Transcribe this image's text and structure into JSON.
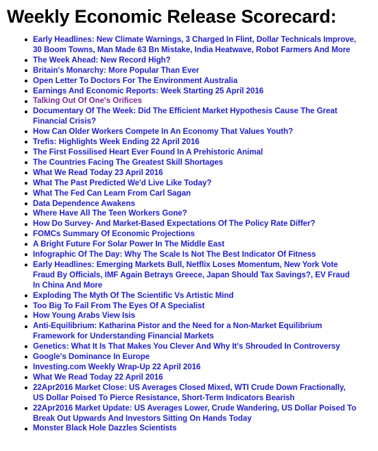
{
  "page": {
    "title": "Weekly Economic Release Scorecard:",
    "background_color": "#ffffff",
    "title_color": "#000000",
    "link_color": "#2222cc",
    "visited_link_color": "#7a2a9e",
    "bullet_glyph": "bullet-point"
  },
  "list": {
    "items": [
      {
        "label": "Early Headlines: New Climate Warnings, 3 Charged In Flint, Dollar Technicals Improve, 30 Boom Towns, Man Made 63 Bn Mistake, India Heatwave, Robot Farmers And More",
        "state": "unvisited"
      },
      {
        "label": "The Week Ahead: New Record High?",
        "state": "unvisited"
      },
      {
        "label": "Britain's Monarchy: More Popular Than Ever",
        "state": "unvisited"
      },
      {
        "label": "Open Letter To Doctors For The Environment Australia",
        "state": "unvisited"
      },
      {
        "label": "Earnings And Economic Reports: Week Starting 25 April 2016",
        "state": "unvisited"
      },
      {
        "label": "Talking Out Of One's Orifices",
        "state": "visited"
      },
      {
        "label": "Documentary Of The Week: Did The Efficient Market Hypothesis Cause The Great Financial Crisis?",
        "state": "unvisited"
      },
      {
        "label": "How Can Older Workers Compete In An Economy That Values Youth?",
        "state": "unvisited"
      },
      {
        "label": "Trefis: Highlights Week Ending 22 April 2016",
        "state": "unvisited"
      },
      {
        "label": "The First Fossilised Heart Ever Found In A Prehistoric Animal",
        "state": "unvisited"
      },
      {
        "label": "The Countries Facing The Greatest Skill Shortages",
        "state": "unvisited"
      },
      {
        "label": "What We Read Today 23 April 2016",
        "state": "unvisited"
      },
      {
        "label": "What The Past Predicted We'd Live Like Today?",
        "state": "unvisited"
      },
      {
        "label": "What The Fed Can Learn From Carl Sagan",
        "state": "unvisited"
      },
      {
        "label": "Data Dependence Awakens",
        "state": "unvisited"
      },
      {
        "label": "Where Have All The Teen Workers Gone?",
        "state": "unvisited"
      },
      {
        "label": "How Do Survey- And Market-Based Expectations Of The Policy Rate Differ?",
        "state": "unvisited"
      },
      {
        "label": "FOMCs Summary Of Economic Projections",
        "state": "unvisited"
      },
      {
        "label": "A Bright Future For Solar Power In The Middle East",
        "state": "unvisited"
      },
      {
        "label": "Infographic Of The Day: Why The Scale Is Not The Best Indicator Of Fitness",
        "state": "unvisited"
      },
      {
        "label": "Early Headlines: Emerging Markets Bull, Netflix Loses Momentum, New York Vote Fraud By Officials, IMF Again Betrays Greece, Japan Should Tax Savings?, EV Fraud In China And More",
        "state": "unvisited"
      },
      {
        "label": "Exploding The Myth Of The Scientific Vs Artistic Mind",
        "state": "unvisited"
      },
      {
        "label": "Too Big To Fail From The Eyes Of A Specialist",
        "state": "unvisited"
      },
      {
        "label": "How Young Arabs View Isis",
        "state": "unvisited"
      },
      {
        "label": "Anti-Equilibrium: Katharina Pistor and the Need for a Non-Market Equilibrium Framework for Understanding Financial Markets",
        "state": "unvisited"
      },
      {
        "label": "Genetics: What It Is That Makes You Clever And Why It's Shrouded In Controversy",
        "state": "unvisited"
      },
      {
        "label": "Google's Dominance In Europe",
        "state": "unvisited"
      },
      {
        "label": "Investing.com Weekly Wrap-Up 22 April 2016",
        "state": "unvisited"
      },
      {
        "label": "What We Read Today 22 April 2016",
        "state": "unvisited"
      },
      {
        "label": "22Apr2016 Market Close: US Averages Closed Mixed, WTI Crude Down Fractionally, US Dollar Poised To Pierce Resistance, Short-Term Indicators Bearish",
        "state": "unvisited"
      },
      {
        "label": "22Apr2016 Market Update: US Averages Lower, Crude Wandering, US Dollar Poised To Break Out Upwards And Investors Sitting On Hands Today",
        "state": "unvisited"
      },
      {
        "label": "Monster Black Hole Dazzles Scientists",
        "state": "unvisited"
      }
    ]
  }
}
